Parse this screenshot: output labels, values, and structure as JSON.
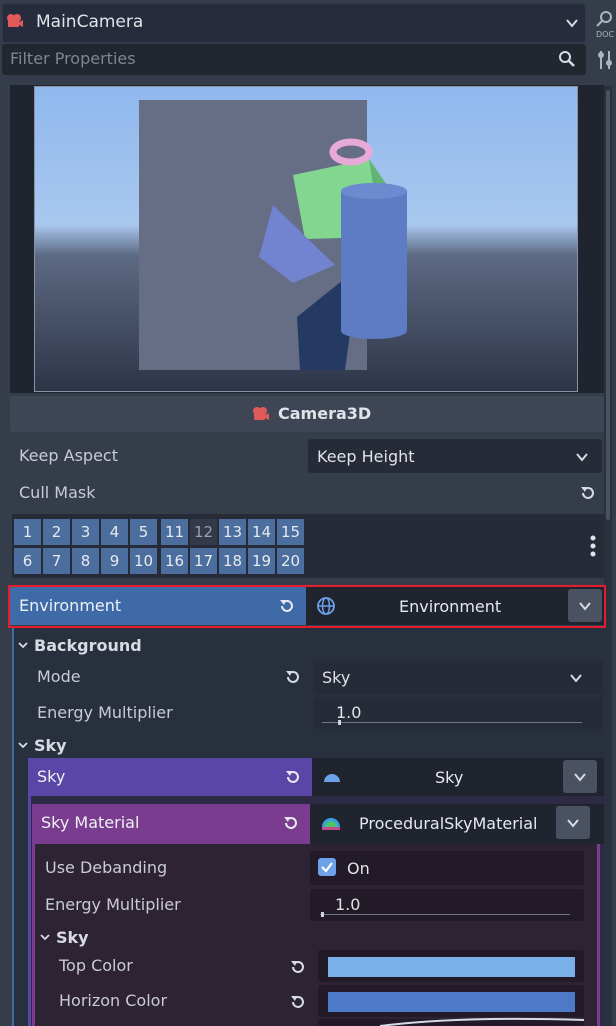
{
  "header": {
    "node_name": "MainCamera",
    "filter_placeholder": "Filter Properties"
  },
  "inspector": {
    "class_name": "Camera3D",
    "keep_aspect": {
      "label": "Keep Aspect",
      "value": "Keep Height"
    },
    "cull_mask": {
      "label": "Cull Mask",
      "row1": [
        "1",
        "2",
        "3",
        "4",
        "5",
        "11",
        "12",
        "13",
        "14",
        "15"
      ],
      "row2": [
        "6",
        "7",
        "8",
        "9",
        "10",
        "16",
        "17",
        "18",
        "19",
        "20"
      ],
      "disabled": [
        "12"
      ]
    },
    "environment": {
      "label": "Environment",
      "value": "Environment"
    },
    "background": {
      "section": "Background",
      "mode": {
        "label": "Mode",
        "value": "Sky"
      },
      "energy": {
        "label": "Energy Multiplier",
        "value": "1.0"
      }
    },
    "sky_section": "Sky",
    "sky": {
      "label": "Sky",
      "value": "Sky"
    },
    "sky_material": {
      "label": "Sky Material",
      "value": "ProceduralSkyMaterial",
      "use_debanding": {
        "label": "Use Debanding",
        "value": "On"
      },
      "energy": {
        "label": "Energy Multiplier",
        "value": "1.0"
      },
      "sky_section": "Sky",
      "top_color": {
        "label": "Top Color",
        "color": "#7ab0ea"
      },
      "horizon_color": {
        "label": "Horizon Color",
        "color": "#4d7ac7"
      }
    }
  },
  "colors": {
    "environment_row": "#3e6aa7",
    "sky_row": "#5a46a6",
    "sky_material_row": "#7a3c8f",
    "highlight": "#e51c2b",
    "camera_icon": "#e05a5a"
  },
  "icons": [
    "camera-icon",
    "chevron-down-icon",
    "doc-icon",
    "search-icon",
    "tools-icon",
    "reset-icon",
    "globe-icon",
    "sky-icon",
    "sky-material-icon",
    "kebab-menu-icon",
    "checkbox-icon"
  ]
}
